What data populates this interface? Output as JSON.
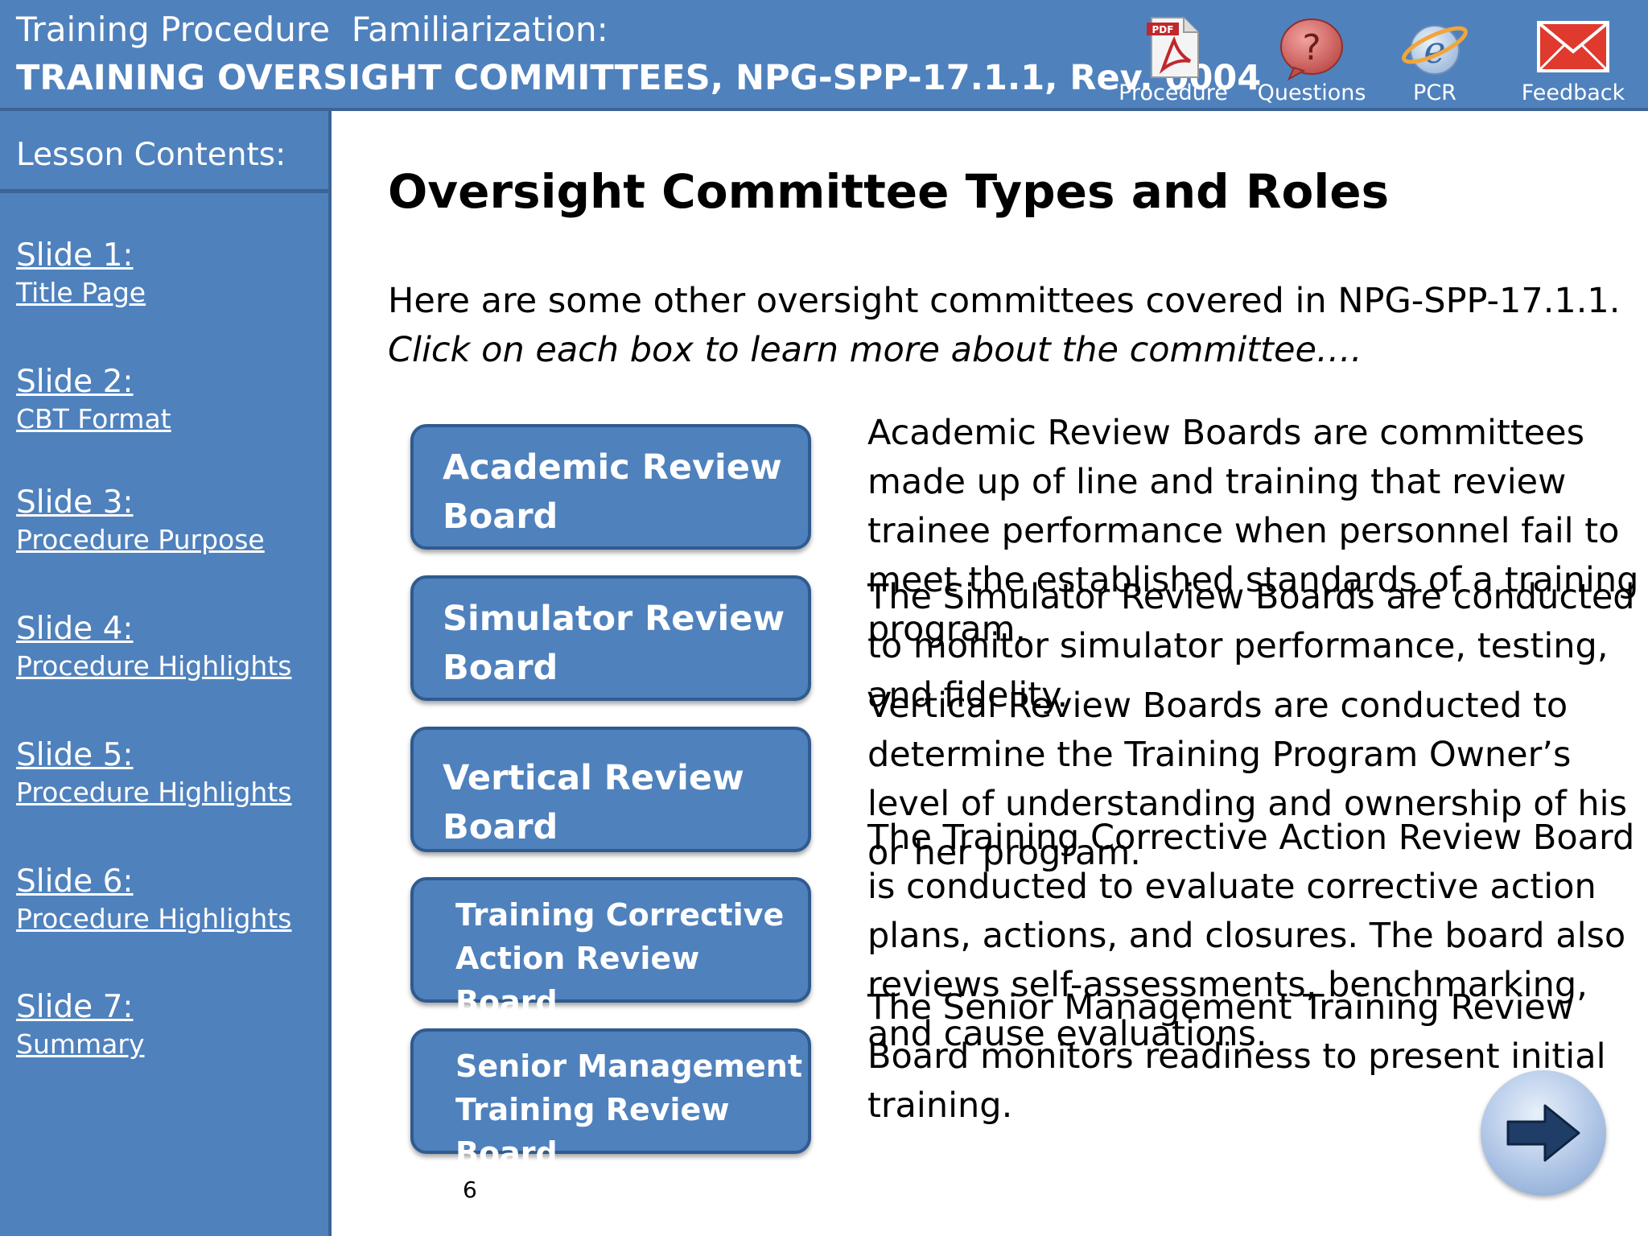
{
  "header": {
    "subtitle": "Training Procedure  Familiarization:",
    "title": "TRAINING OVERSIGHT COMMITTEES, NPG-SPP-17.1.1, Rev. 0004",
    "tools": [
      {
        "label": "Procedure",
        "icon": "pdf-icon"
      },
      {
        "label": "Questions",
        "icon": "question-icon"
      },
      {
        "label": "PCR",
        "icon": "pcr-icon"
      },
      {
        "label": "Feedback",
        "icon": "envelope-icon"
      }
    ]
  },
  "sidebar": {
    "heading": "Lesson Contents:",
    "items": [
      {
        "num": "Slide 1:",
        "sub": "Title Page"
      },
      {
        "num": "Slide 2:",
        "sub": "CBT Format"
      },
      {
        "num": "Slide 3:",
        "sub": "Procedure Purpose"
      },
      {
        "num": "Slide 4:",
        "sub": "Procedure Highlights"
      },
      {
        "num": "Slide 5:",
        "sub": "Procedure Highlights"
      },
      {
        "num": "Slide 6:",
        "sub": "Procedure Highlights"
      },
      {
        "num": "Slide 7:",
        "sub": "Summary"
      }
    ]
  },
  "main": {
    "title": "Oversight Committee Types and Roles",
    "intro": "Here are some other oversight committees covered in NPG-SPP-17.1.1.",
    "instruction": "Click on each box to learn more about the committee….",
    "committees": [
      {
        "line1": "Academic Review",
        "line2": "Board"
      },
      {
        "line1": "Simulator Review",
        "line2": "Board"
      },
      {
        "line1": "Vertical Review",
        "line2": "Board"
      },
      {
        "line1": "Training Corrective",
        "line2": "Action Review Board"
      },
      {
        "line1": "Senior Management",
        "line2": "Training Review Board"
      }
    ],
    "descriptions": [
      "Academic Review Boards are committees made up of line and training that review trainee performance when personnel fail to meet the established standards of a training program.",
      "The Simulator Review Boards are conducted to monitor simulator performance, testing, and fidelity.",
      "Vertical Review Boards are conducted to determine the Training Program Owner’s level of understanding and ownership of his or her program.",
      "The Training Corrective Action Review Board is conducted to evaluate corrective action plans, actions, and closures. The board also reviews self-assessments, benchmarking, and cause evaluations.",
      "The Senior Management Training Review Board monitors readiness to present initial training."
    ],
    "page_number": "6"
  },
  "colors": {
    "header_bg": "#4f81bd",
    "sidebar_bg": "#4f81bd",
    "box_bg": "#4f81bd",
    "box_border": "#2f5b8f"
  },
  "icons": {
    "next": "next-arrow-icon"
  }
}
